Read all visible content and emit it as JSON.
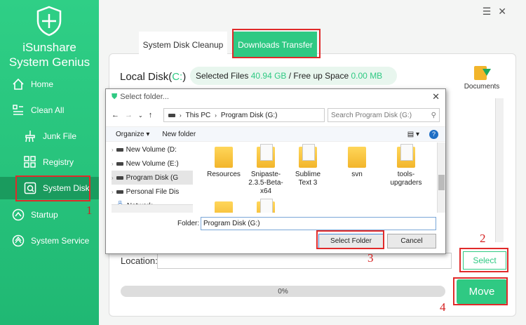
{
  "app": {
    "brand_line1": "iSunshare",
    "brand_line2": "System Genius",
    "window_controls": [
      "menu-icon",
      "close-icon"
    ]
  },
  "sidebar": {
    "items": [
      {
        "label": "Home",
        "icon": "home-icon"
      },
      {
        "label": "Clean All",
        "icon": "clean-icon"
      },
      {
        "label": "Junk File",
        "icon": "broom-icon"
      },
      {
        "label": "Registry",
        "icon": "registry-icon"
      },
      {
        "label": "System Disk",
        "icon": "disk-icon",
        "active": true
      },
      {
        "label": "Startup",
        "icon": "startup-icon"
      },
      {
        "label": "System Service",
        "icon": "service-icon"
      }
    ]
  },
  "tabs": [
    {
      "label": "System Disk Cleanup"
    },
    {
      "label": "Downloads Transfer",
      "active": true
    }
  ],
  "main": {
    "disk_title_prefix": "Local Disk(",
    "disk_letter": "C:",
    "disk_title_suffix": ")",
    "selected_files_label": "Selected Files",
    "selected_files_value": "40.94 GB",
    "free_up_label": "/ Free up Space",
    "free_up_value": "0.00 MB",
    "documents_label": "Documents",
    "location_label": "Location:",
    "location_value": "",
    "select_button": "Select",
    "progress_text": "0%",
    "progress": 0,
    "move_button": "Move"
  },
  "dialog": {
    "title": "Select folder...",
    "breadcrumb": [
      "This PC",
      "Program Disk  (G:)"
    ],
    "search_placeholder": "Search Program Disk  (G:)",
    "organize": "Organize",
    "new_folder": "New folder",
    "tree": [
      {
        "label": "New Volume (D:"
      },
      {
        "label": "New Volume (E:)"
      },
      {
        "label": "Program Disk  (G"
      },
      {
        "label": "Personal File Dis"
      },
      {
        "label": "Network"
      }
    ],
    "files": [
      {
        "label": "Resources"
      },
      {
        "label": "Snipaste-2.3.5-Beta-x64"
      },
      {
        "label": "Sublime Text 3"
      },
      {
        "label": "svn"
      },
      {
        "label": "tools-upgraders"
      }
    ],
    "folder_label": "Folder:",
    "folder_value": "Program Disk  (G:)",
    "select_folder_button": "Select Folder",
    "cancel_button": "Cancel"
  },
  "annotations": [
    "1",
    "2",
    "3",
    "4"
  ],
  "colors": {
    "accent": "#2fc983",
    "highlight_box": "#e02a2a"
  }
}
